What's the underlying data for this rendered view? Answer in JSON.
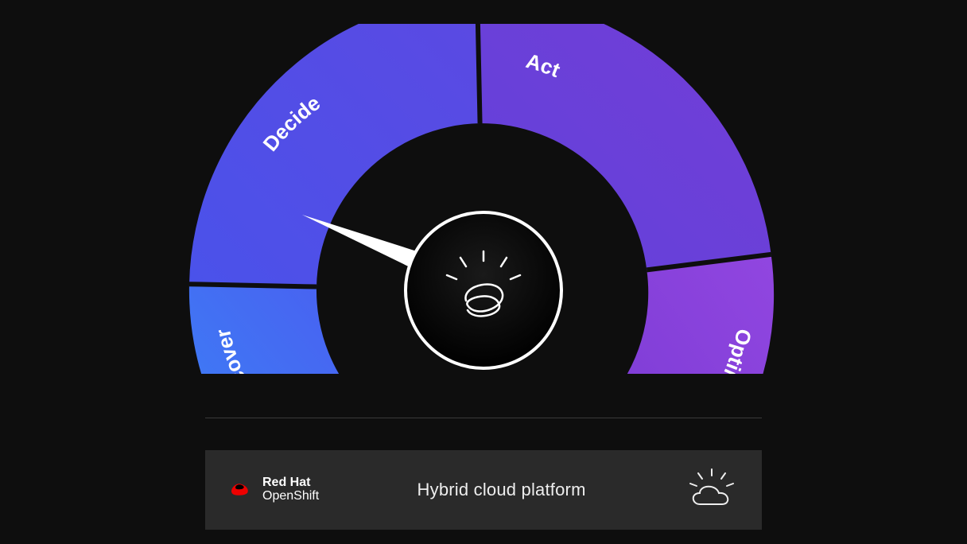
{
  "gauge": {
    "segments": [
      {
        "label": "Discover",
        "color_from": "#3b82f6",
        "color_to": "#4a5ef0"
      },
      {
        "label": "Decide",
        "color_from": "#4a52ea",
        "color_to": "#5b49e2"
      },
      {
        "label": "Act",
        "color_from": "#6242db",
        "color_to": "#733dd6"
      },
      {
        "label": "Optimize",
        "color_from": "#7a3bd4",
        "color_to": "#9146e0"
      }
    ],
    "pointer_segment_index": 0
  },
  "footer": {
    "logo_primary": "Red Hat",
    "logo_secondary": "OpenShift",
    "title": "Hybrid cloud platform"
  }
}
